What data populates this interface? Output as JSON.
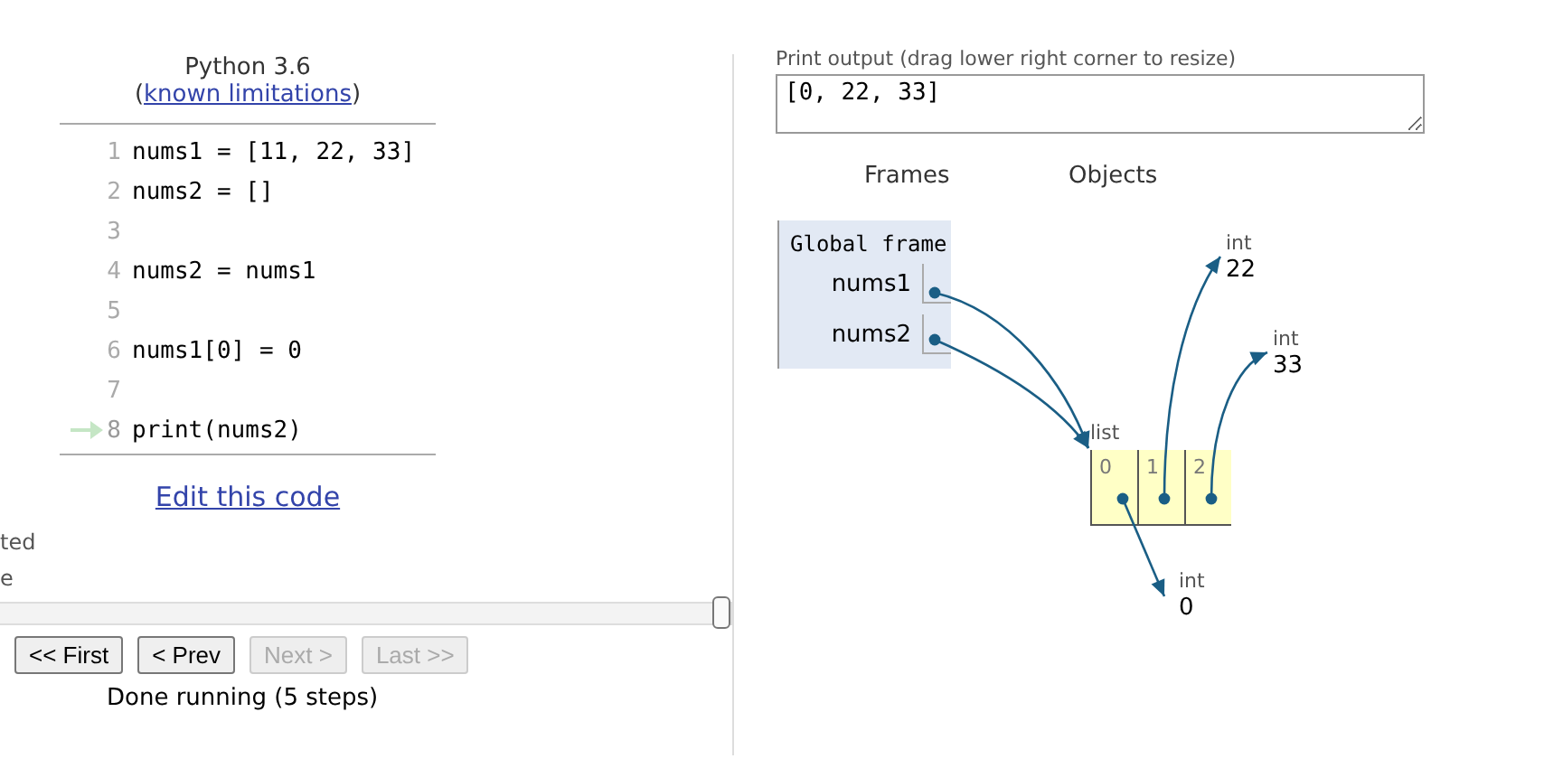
{
  "editor": {
    "language": "Python 3.6",
    "limitations_open": "(",
    "limitations_link": "known limitations",
    "limitations_close": ")",
    "lines": [
      {
        "number": "1",
        "code": "nums1 = [11, 22, 33]",
        "current": false
      },
      {
        "number": "2",
        "code": "nums2 = []",
        "current": false
      },
      {
        "number": "3",
        "current": false
      },
      {
        "number": "4",
        "code": "nums2 = nums1",
        "current": false
      },
      {
        "number": "5",
        "current": false
      },
      {
        "number": "6",
        "code": "nums1[0] = 0",
        "current": false
      },
      {
        "number": "7",
        "current": false
      },
      {
        "number": "8",
        "code": "print(nums2)",
        "current": true
      }
    ],
    "edit_link": "Edit this code",
    "cut_texts": [
      "ted",
      "e"
    ]
  },
  "slider": {
    "level": 1
  },
  "buttons": [
    {
      "label": "<< First",
      "disabled": false
    },
    {
      "label": "< Prev",
      "disabled": false
    },
    {
      "label": "Next >",
      "disabled": true
    },
    {
      "label": "Last >>",
      "disabled": true
    }
  ],
  "status": "Done running (5 steps)",
  "output": {
    "label": "Print output (drag lower right corner to resize)",
    "value": "[0, 22, 33]"
  },
  "visualizer": {
    "frames_header": "Frames",
    "objects_header": "Objects",
    "frame": {
      "title": "Global frame",
      "variables": [
        "nums1",
        "nums2"
      ]
    },
    "list": {
      "type": "list",
      "indices": [
        "0",
        "1",
        "2"
      ]
    },
    "ints": [
      {
        "type": "int",
        "value": "22"
      },
      {
        "type": "int",
        "value": "33"
      },
      {
        "type": "int",
        "value": "0"
      }
    ]
  }
}
